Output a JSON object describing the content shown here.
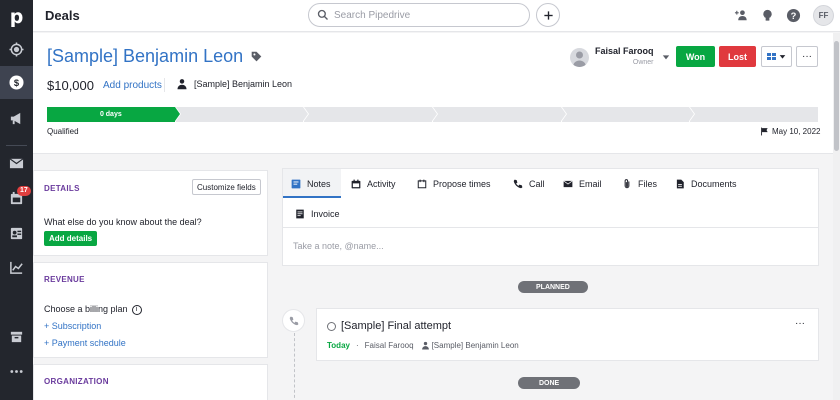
{
  "app": {
    "logo": "p",
    "page_title": "Deals"
  },
  "search": {
    "placeholder": "Search Pipedrive"
  },
  "sidebar": {
    "items": [
      {
        "icon": "target-icon"
      },
      {
        "icon": "dollar-icon",
        "active": true
      },
      {
        "icon": "megaphone-icon"
      },
      {
        "icon": "mail-icon"
      },
      {
        "icon": "calendar-icon",
        "badge": "17"
      },
      {
        "icon": "contacts-icon"
      },
      {
        "icon": "chart-icon"
      },
      {
        "icon": "box-icon"
      },
      {
        "icon": "more-icon"
      }
    ]
  },
  "topbar": {
    "user_initials": "FF"
  },
  "deal": {
    "title": "[Sample] Benjamin Leon",
    "value": "$10,000",
    "add_products": "Add products",
    "person": "[Sample] Benjamin Leon",
    "owner_name": "Faisal Farooq",
    "owner_role": "Owner",
    "won_label": "Won",
    "lost_label": "Lost",
    "more_label": "···",
    "stage_days": "0 days",
    "stage_name": "Qualified",
    "stage_date": "May 10, 2022"
  },
  "details_card": {
    "title": "DETAILS",
    "customize": "Customize fields",
    "question": "What else do you know about the deal?",
    "add_details": "Add details"
  },
  "revenue_card": {
    "title": "REVENUE",
    "billing": "Choose a billing plan",
    "info": "i",
    "subscription": "+ Subscription",
    "payment": "+ Payment schedule"
  },
  "organization_card": {
    "title": "ORGANIZATION"
  },
  "composer": {
    "tabs": [
      "Notes",
      "Activity",
      "Propose times",
      "Call",
      "Email",
      "Files",
      "Documents",
      "Invoice"
    ],
    "placeholder": "Take a note, @name..."
  },
  "timeline": {
    "planned_label": "PLANNED",
    "done_label": "DONE",
    "activity": {
      "title": "[Sample] Final attempt",
      "when": "Today",
      "dot": "·",
      "owner": "Faisal Farooq",
      "person": "[Sample] Benjamin Leon",
      "more": "···"
    }
  },
  "colors": {
    "won": "#08a742",
    "lost": "#e0393e",
    "accent": "#3273c5",
    "section_title": "#6a3b9d"
  }
}
